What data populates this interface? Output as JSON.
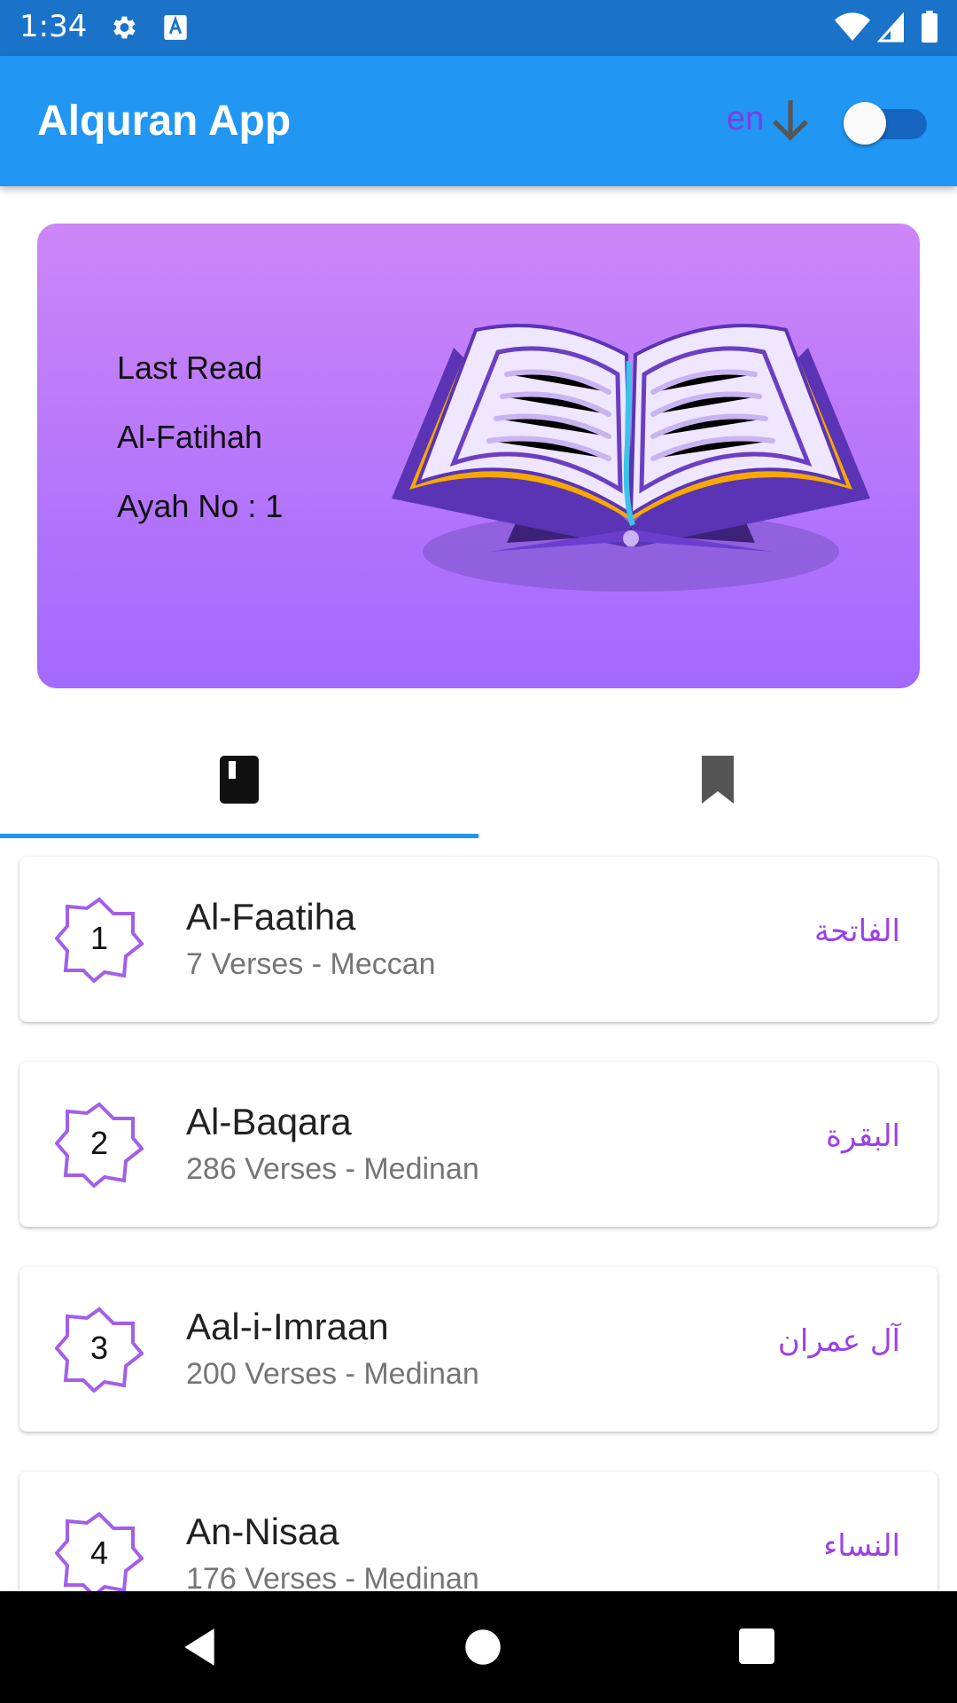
{
  "status_bar": {
    "time": "1:34"
  },
  "app_bar": {
    "title": "Alquran App",
    "language": "en"
  },
  "last_read": {
    "heading": "Last Read",
    "surah": "Al-Fatihah",
    "ayah": "Ayah No : 1"
  },
  "tabs": [
    {
      "icon": "book-icon",
      "selected": true
    },
    {
      "icon": "bookmark-icon",
      "selected": false
    }
  ],
  "colors": {
    "app_bar": "#2196f3",
    "status_bar": "#1a73c9",
    "accent_purple": "#9b40e8",
    "card_top": "#cd86f7",
    "card_bottom": "#a369ff"
  },
  "surahs": [
    {
      "number": "1",
      "name": "Al-Faatiha",
      "meta": "7 Verses - Meccan",
      "arabic": "الفاتحة"
    },
    {
      "number": "2",
      "name": "Al-Baqara",
      "meta": "286 Verses - Medinan",
      "arabic": "البقرة"
    },
    {
      "number": "3",
      "name": "Aal-i-Imraan",
      "meta": "200 Verses - Medinan",
      "arabic": "آل عمران"
    },
    {
      "number": "4",
      "name": "An-Nisaa",
      "meta": "176 Verses - Medinan",
      "arabic": "النساء"
    }
  ]
}
